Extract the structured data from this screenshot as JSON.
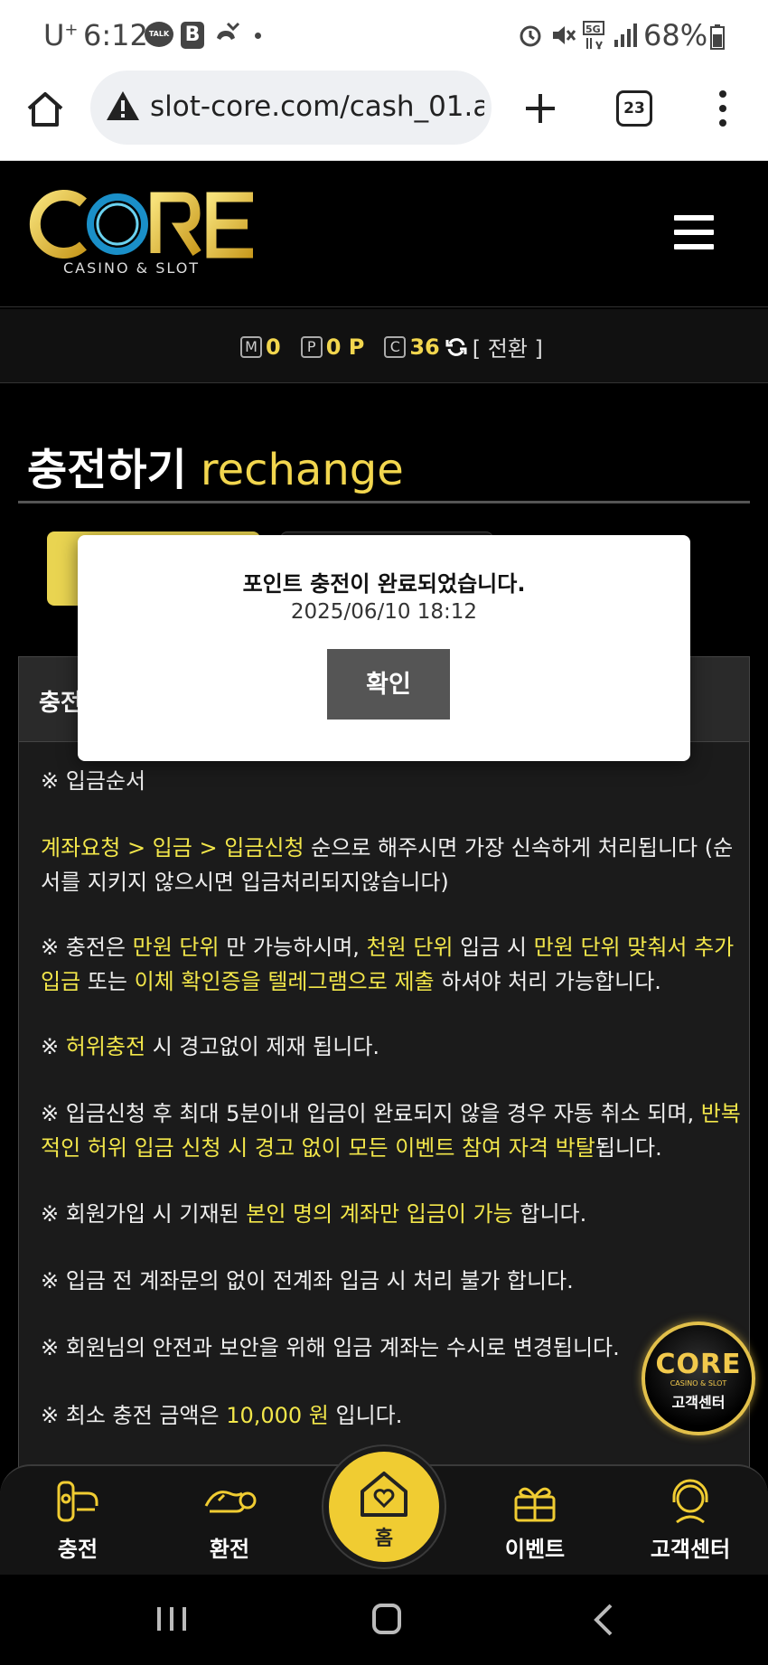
{
  "status_bar": {
    "carrier": "U",
    "carrier_sup": "+",
    "time": "6:12",
    "talk_icon_text": "TALK",
    "b_icon_text": "B",
    "battery": "68%"
  },
  "browser": {
    "url": "slot-core.com/cash_01.a",
    "tab_count": "23"
  },
  "header": {
    "logo_text": "CORE",
    "logo_sub": "CASINO & SLOT"
  },
  "points": {
    "m_badge": "M",
    "m_value": "0",
    "p_badge": "P",
    "p_value": "0 P",
    "c_badge": "C",
    "c_value": "36",
    "convert_label": "[ 전환 ]"
  },
  "page": {
    "title_ko": "충전하기",
    "title_en": "rechange",
    "panel_head": "충전"
  },
  "modal": {
    "message": "포인트 충전이 완료되었습니다.",
    "timestamp": "2025/06/10 18:12",
    "confirm_label": "확인"
  },
  "notices": {
    "order_title": "※ 입금순서",
    "order_hl": "계좌요청 > 입금 > 입금신청",
    "order_rest": " 순으로 해주시면 가장 신속하게 처리됩니다 (순서를 지키지 않으시면 입금처리되지않습니다)",
    "unit_1": "※ 충전은 ",
    "unit_2": "만원 단위",
    "unit_3": " 만 가능하시며, ",
    "unit_4": "천원 단위",
    "unit_5": " 입금 시 ",
    "unit_6": "만원 단위 맞춰서 추가입금",
    "unit_7": " 또는 ",
    "unit_8": "이체 확인증을 텔레그램으로 제출",
    "unit_9": " 하셔야 처리 가능합니다.",
    "false_1": "※ ",
    "false_2": "허위충전",
    "false_3": " 시 경고없이 제재 됩니다.",
    "cancel_1": "※ 입금신청 후 최대 5분이내 입금이 완료되지 않을 경우 자동 취소 되며, ",
    "cancel_2": "반복적인 허위 입금 신청 시 경고 없이 모든 이벤트 참여 자격 박탈",
    "cancel_3": "됩니다.",
    "own_1": "※ 회원가입 시 기재된 ",
    "own_2": "본인 명의 계좌만 입금이 가능",
    "own_3": " 합니다.",
    "prev": "※ 입금 전 계좌문의 없이 전계좌 입금 시 처리 불가 합니다.",
    "security": "※ 회원님의 안전과 보안을 위해 입금 계좌는 수시로 변경됩니다.",
    "min_1": "※ 최소 충전 금액은 ",
    "min_2": "10,000 원",
    "min_3": " 입니다."
  },
  "support_badge": {
    "logo": "CORE",
    "sub": "CASINO & SLOT",
    "label": "고객센터"
  },
  "bottom_nav": {
    "charge": "충전",
    "exchange": "환전",
    "home": "홈",
    "event": "이벤트",
    "support": "고객센터"
  },
  "colors": {
    "accent_yellow": "#f2e64a",
    "gold": "#f0cc32",
    "background": "#000000"
  }
}
